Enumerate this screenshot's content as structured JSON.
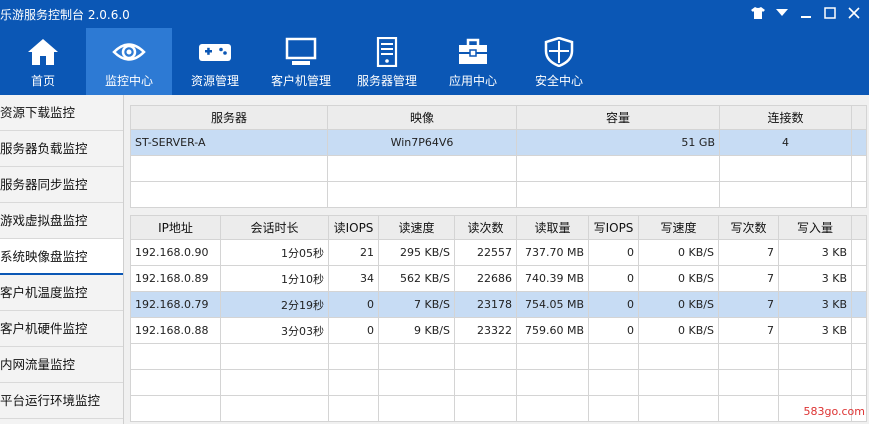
{
  "window": {
    "title": "乐游服务控制台 2.0.6.0",
    "controls": [
      "shirt-icon",
      "dropdown-icon",
      "minimize-icon",
      "maximize-icon",
      "close-icon"
    ]
  },
  "toolbar": {
    "items": [
      {
        "label": "首页",
        "icon": "home-icon"
      },
      {
        "label": "监控中心",
        "icon": "eye-icon",
        "active": true
      },
      {
        "label": "资源管理",
        "icon": "gamepad-icon"
      },
      {
        "label": "客户机管理",
        "icon": "monitor-icon"
      },
      {
        "label": "服务器管理",
        "icon": "server-icon"
      },
      {
        "label": "应用中心",
        "icon": "toolbox-icon"
      },
      {
        "label": "安全中心",
        "icon": "shield-icon"
      }
    ]
  },
  "sidebar": {
    "items": [
      {
        "label": "资源下载监控"
      },
      {
        "label": "服务器负载监控"
      },
      {
        "label": "服务器同步监控"
      },
      {
        "label": "游戏虚拟盘监控"
      },
      {
        "label": "系统映像盘监控",
        "active": true
      },
      {
        "label": "客户机温度监控"
      },
      {
        "label": "客户机硬件监控"
      },
      {
        "label": "内网流量监控"
      },
      {
        "label": "平台运行环境监控"
      }
    ]
  },
  "server_table": {
    "headers": [
      "服务器",
      "映像",
      "容量",
      "连接数"
    ],
    "rows": [
      [
        "ST-SERVER-A",
        "Win7P64V6",
        "51 GB",
        "4"
      ]
    ]
  },
  "session_table": {
    "headers": [
      "IP地址",
      "会话时长",
      "读IOPS",
      "读速度",
      "读次数",
      "读取量",
      "写IOPS",
      "写速度",
      "写次数",
      "写入量"
    ],
    "rows": [
      [
        "192.168.0.90",
        "1分05秒",
        "21",
        "295 KB/S",
        "22557",
        "737.70 MB",
        "0",
        "0 KB/S",
        "7",
        "3 KB"
      ],
      [
        "192.168.0.89",
        "1分10秒",
        "34",
        "562 KB/S",
        "22686",
        "740.39 MB",
        "0",
        "0 KB/S",
        "7",
        "3 KB"
      ],
      [
        "192.168.0.79",
        "2分19秒",
        "0",
        "7 KB/S",
        "23178",
        "754.05 MB",
        "0",
        "0 KB/S",
        "7",
        "3 KB"
      ],
      [
        "192.168.0.88",
        "3分03秒",
        "0",
        "9 KB/S",
        "23322",
        "759.60 MB",
        "0",
        "0 KB/S",
        "7",
        "3 KB"
      ]
    ]
  },
  "watermark": {
    "text": "583go.com"
  },
  "colors": {
    "titlebar": "#0b57b5",
    "toolbar_active": "#2d7ad4",
    "row_selected": "#c7dcf4"
  }
}
